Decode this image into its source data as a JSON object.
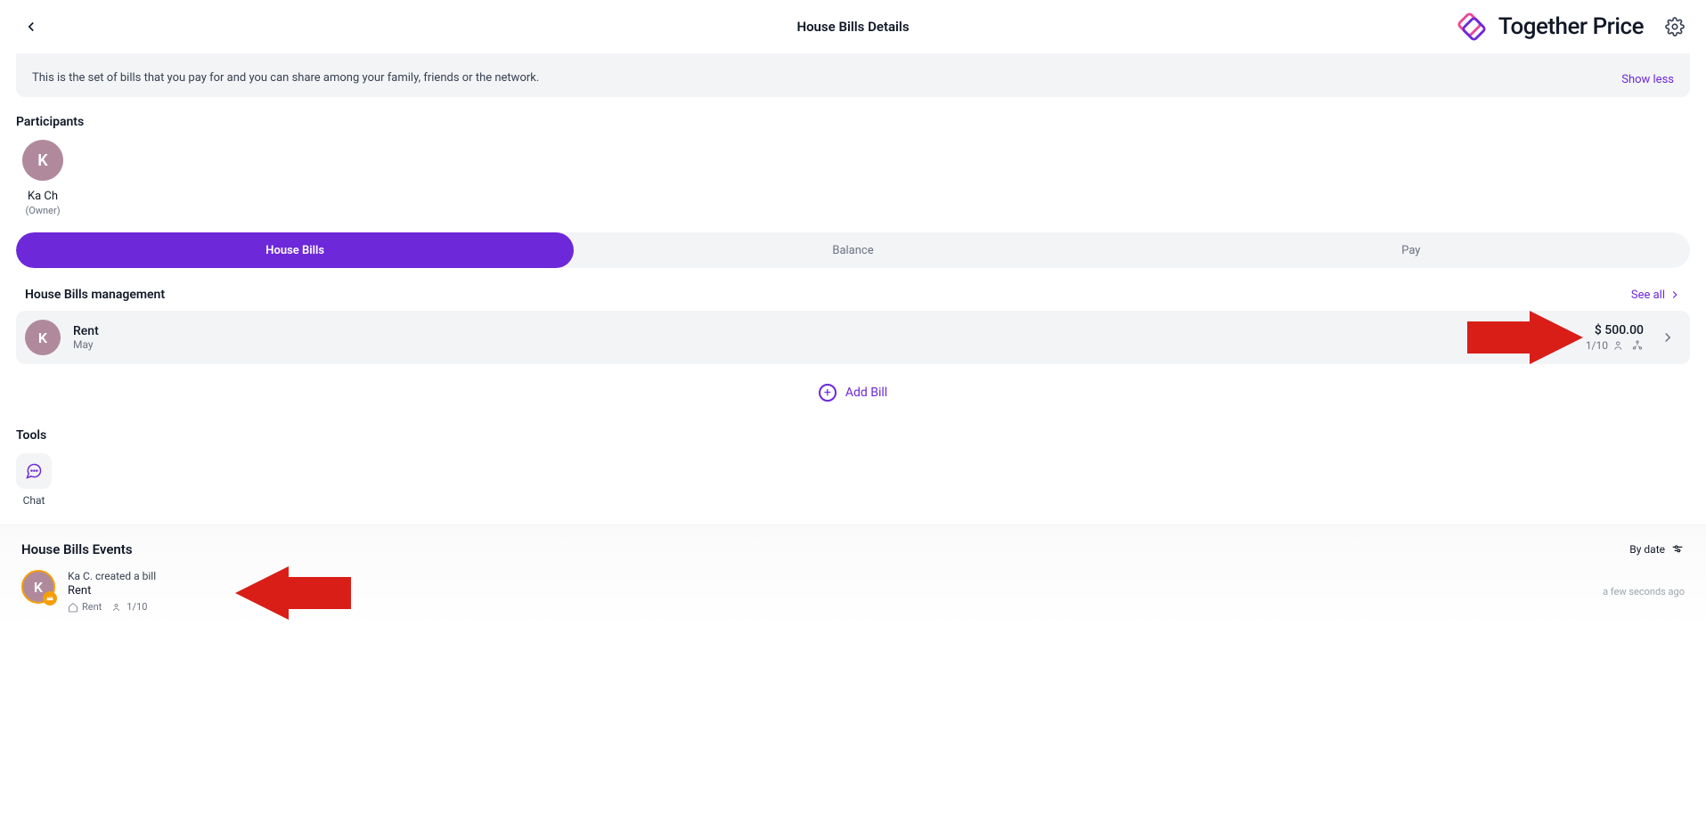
{
  "header": {
    "title": "House Bills Details",
    "brand": "Together Price"
  },
  "desc": {
    "text": "This is the set of bills that you pay for and you can share among your family, friends or the network.",
    "show_less": "Show less"
  },
  "participants": {
    "title": "Participants",
    "items": [
      {
        "initial": "K",
        "name": "Ka Ch",
        "role": "(Owner)"
      }
    ]
  },
  "tabs": {
    "items": [
      {
        "label": "House Bills",
        "active": true
      },
      {
        "label": "Balance",
        "active": false
      },
      {
        "label": "Pay",
        "active": false
      }
    ]
  },
  "management": {
    "title": "House Bills management",
    "see_all": "See all",
    "bills": [
      {
        "initial": "K",
        "name": "Rent",
        "sub": "May",
        "amount": "$ 500.00",
        "ratio": "1/10"
      }
    ],
    "add_label": "Add Bill"
  },
  "tools": {
    "title": "Tools",
    "items": [
      {
        "label": "Chat",
        "icon": "chat-icon"
      }
    ]
  },
  "events": {
    "title": "House Bills Events",
    "sort_label": "By date",
    "items": [
      {
        "initial": "K",
        "line1": "Ka C. created a bill",
        "line2": "Rent",
        "meta_bill": "Rent",
        "meta_ratio": "1/10",
        "time": "a few seconds ago"
      }
    ]
  },
  "annotations": {
    "arrow1_color": "#d91e18",
    "arrow2_color": "#d91e18"
  }
}
